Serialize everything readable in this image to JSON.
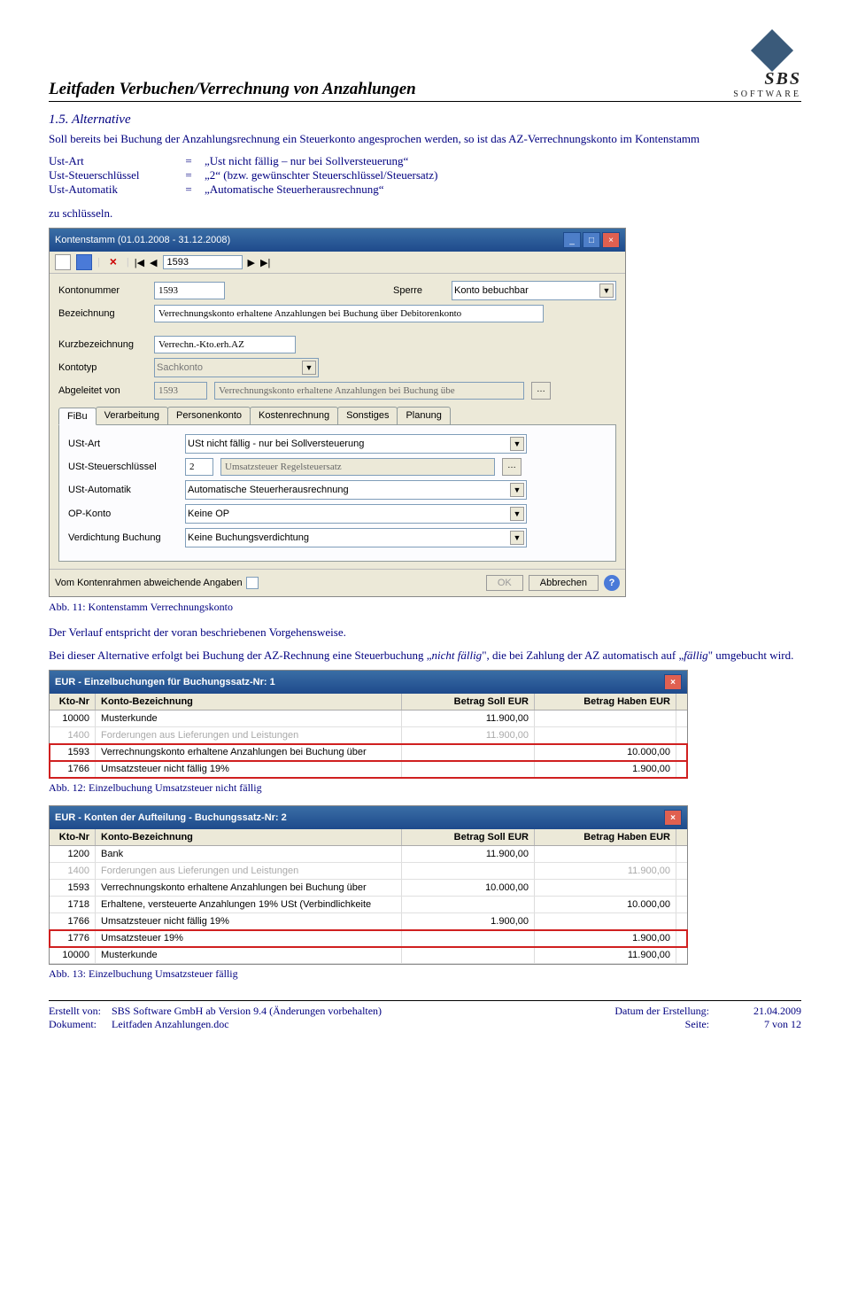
{
  "header": {
    "doc_title": "Leitfaden Verbuchen/Verrechnung von Anzahlungen",
    "logo_top": "SBS",
    "logo_bot": "SOFTWARE"
  },
  "section": {
    "num_title": "1.5. Alternative",
    "intro": "Soll bereits bei Buchung der Anzahlungsrechnung ein Steuerkonto angesprochen werden, so ist das AZ-Verrechnungskonto im Kontenstamm",
    "params": [
      {
        "k": "Ust-Art",
        "v": "„Ust nicht fällig – nur bei Sollversteuerung“"
      },
      {
        "k": "Ust-Steuerschlüssel",
        "v": "„2“ (bzw. gewünschter Steuerschlüssel/Steuersatz)"
      },
      {
        "k": "Ust-Automatik",
        "v": "„Automatische Steuerherausrechnung“"
      }
    ],
    "close": "zu schlüsseln."
  },
  "win1": {
    "title": "Kontenstamm (01.01.2008 - 31.12.2008)",
    "nav": "1593",
    "kontonummer_lab": "Kontonummer",
    "kontonummer": "1593",
    "sperre_lab": "Sperre",
    "sperre": "Konto bebuchbar",
    "bez_lab": "Bezeichnung",
    "bez": "Verrechnungskonto erhaltene Anzahlungen bei Buchung über Debitorenkonto",
    "kurzbez_lab": "Kurzbezeichnung",
    "kurzbez": "Verrechn.-Kto.erh.AZ",
    "kontotyp_lab": "Kontotyp",
    "kontotyp": "Sachkonto",
    "abg_lab": "Abgeleitet von",
    "abg_num": "1593",
    "abg_txt": "Verrechnungskonto erhaltene Anzahlungen bei Buchung übe",
    "tabs": [
      "FiBu",
      "Verarbeitung",
      "Personenkonto",
      "Kostenrechnung",
      "Sonstiges",
      "Planung"
    ],
    "ustart_lab": "USt-Art",
    "ustart": "USt nicht fällig - nur bei Sollversteuerung",
    "ustkey_lab": "USt-Steuerschlüssel",
    "ustkey_n": "2",
    "ustkey_txt": "Umsatzsteuer Regelsteuersatz",
    "ustauto_lab": "USt-Automatik",
    "ustauto": "Automatische Steuerherausrechnung",
    "op_lab": "OP-Konto",
    "op": "Keine OP",
    "verd_lab": "Verdichtung Buchung",
    "verd": "Keine Buchungsverdichtung",
    "foot_check": "Vom Kontenrahmen abweichende Angaben",
    "ok": "OK",
    "cancel": "Abbrechen"
  },
  "cap11": "Abb. 11: Kontenstamm Verrechnungskonto",
  "mid1": "Der Verlauf entspricht der voran beschriebenen Vorgehensweise.",
  "mid2": "Bei dieser Alternative erfolgt bei Buchung der AZ-Rechnung eine Steuerbuchung „nicht fällig“, die bei Zahlung der AZ automatisch auf „fällig“ umgebucht wird.",
  "grid12": {
    "title": "EUR - Einzelbuchungen für Buchungssatz-Nr: 1",
    "h": [
      "Kto-Nr",
      "Konto-Bezeichnung",
      "Betrag Soll EUR",
      "Betrag Haben EUR"
    ],
    "rows": [
      {
        "a": "10000",
        "b": "Musterkunde",
        "s": "11.900,00",
        "h": ""
      },
      {
        "a": "1400",
        "b": "Forderungen aus Lieferungen und Leistungen",
        "s": "11.900,00",
        "h": "",
        "dis": true
      },
      {
        "a": "1593",
        "b": "Verrechnungskonto erhaltene Anzahlungen bei Buchung über",
        "s": "",
        "h": "10.000,00",
        "hl": true
      },
      {
        "a": "1766",
        "b": "Umsatzsteuer nicht fällig 19%",
        "s": "",
        "h": "1.900,00",
        "hl": true
      }
    ]
  },
  "cap12": "Abb. 12: Einzelbuchung Umsatzsteuer nicht fällig",
  "grid13": {
    "title": "EUR - Konten der Aufteilung - Buchungssatz-Nr: 2",
    "h": [
      "Kto-Nr",
      "Konto-Bezeichnung",
      "Betrag Soll EUR",
      "Betrag Haben EUR"
    ],
    "rows": [
      {
        "a": "1200",
        "b": "Bank",
        "s": "11.900,00",
        "h": ""
      },
      {
        "a": "1400",
        "b": "Forderungen aus Lieferungen und Leistungen",
        "s": "",
        "h": "11.900,00",
        "dis": true
      },
      {
        "a": "1593",
        "b": "Verrechnungskonto erhaltene Anzahlungen bei Buchung über",
        "s": "10.000,00",
        "h": ""
      },
      {
        "a": "1718",
        "b": "Erhaltene, versteuerte Anzahlungen 19% USt (Verbindlichkeite",
        "s": "",
        "h": "10.000,00"
      },
      {
        "a": "1766",
        "b": "Umsatzsteuer nicht fällig 19%",
        "s": "1.900,00",
        "h": ""
      },
      {
        "a": "1776",
        "b": "Umsatzsteuer 19%",
        "s": "",
        "h": "1.900,00",
        "hl": true
      },
      {
        "a": "10000",
        "b": "Musterkunde",
        "s": "",
        "h": "11.900,00"
      }
    ]
  },
  "cap13": "Abb. 13: Einzelbuchung Umsatzsteuer fällig",
  "foot": {
    "l1a": "Erstellt von:",
    "l1b": "SBS Software GmbH ab Version 9.4 (Änderungen vorbehalten)",
    "l2a": "Dokument:",
    "l2b": "Leitfaden Anzahlungen.doc",
    "r1a": "Datum der Erstellung:",
    "r1b": "21.04.2009",
    "r2a": "Seite:",
    "r2b": "7 von 12"
  }
}
